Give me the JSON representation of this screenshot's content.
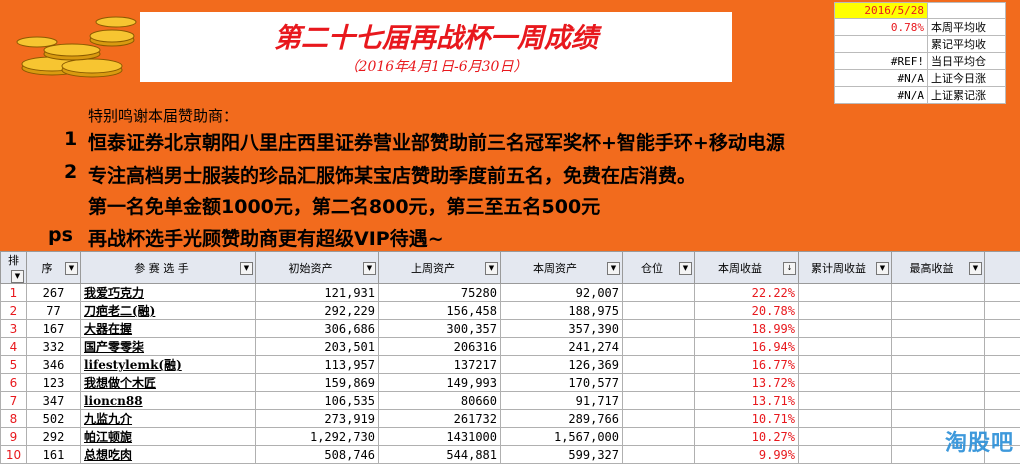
{
  "header": {
    "title": "第二十七届再战杯一周成绩",
    "subtitle": "（2016年4月1日-6月30日）",
    "date": "2016/5/28",
    "stats": [
      {
        "value": "0.78%",
        "label": "本周平均收",
        "red": true
      },
      {
        "value": "",
        "label": "累记平均收",
        "red": false
      },
      {
        "value": "#REF!",
        "label": "当日平均仓",
        "red": false
      },
      {
        "value": "#N/A",
        "label": "上证今日涨",
        "red": false
      },
      {
        "value": "#N/A",
        "label": "上证累记涨",
        "red": false
      }
    ]
  },
  "sponsors": {
    "heading": "特别鸣谢本届赞助商：",
    "item1_num": "1",
    "item1": "恒泰证券北京朝阳八里庄西里证券营业部赞助前三名冠军奖杯+智能手环+移动电源",
    "item2_num": "2",
    "item2": "专注高档男士服装的珍品汇服饰某宝店赞助季度前五名，免费在店消费。",
    "item2b": "第一名免单金额1000元，第二名800元，第三至五名500元",
    "ps_label": "ps",
    "ps": "再战杯选手光顾赞助商更有超级VIP待遇~"
  },
  "table": {
    "columns": [
      "排",
      "序",
      "参 赛 选 手",
      "初始资产",
      "上周资产",
      "本周资产",
      "仓位",
      "本周收益",
      "累计周收益",
      "最高收益"
    ],
    "rows": [
      {
        "rank": "1",
        "id": "267",
        "name": "我爱巧克力",
        "init": "121,931",
        "last": "75280",
        "cur": "92,007",
        "pos": "",
        "gain": "22.22%"
      },
      {
        "rank": "2",
        "id": "77",
        "name": "刀疤老二(融)",
        "init": "292,229",
        "last": "156,458",
        "cur": "188,975",
        "pos": "",
        "gain": "20.78%"
      },
      {
        "rank": "3",
        "id": "167",
        "name": "大器在握",
        "init": "306,686",
        "last": "300,357",
        "cur": "357,390",
        "pos": "",
        "gain": "18.99%"
      },
      {
        "rank": "4",
        "id": "332",
        "name": "国产零零柒",
        "init": "203,501",
        "last": "206316",
        "cur": "241,274",
        "pos": "",
        "gain": "16.94%"
      },
      {
        "rank": "5",
        "id": "346",
        "name": "lifestylemk(融)",
        "init": "113,957",
        "last": "137217",
        "cur": "126,369",
        "pos": "",
        "gain": "16.77%"
      },
      {
        "rank": "6",
        "id": "123",
        "name": "我想做个木匠",
        "init": "159,869",
        "last": "149,993",
        "cur": "170,577",
        "pos": "",
        "gain": "13.72%"
      },
      {
        "rank": "7",
        "id": "347",
        "name": "lioncn88",
        "init": "106,535",
        "last": "80660",
        "cur": "91,717",
        "pos": "",
        "gain": "13.71%"
      },
      {
        "rank": "8",
        "id": "502",
        "name": "九监九介",
        "init": "273,919",
        "last": "261732",
        "cur": "289,766",
        "pos": "",
        "gain": "10.71%"
      },
      {
        "rank": "9",
        "id": "292",
        "name": "帕江顿旎",
        "init": "1,292,730",
        "last": "1431000",
        "cur": "1,567,000",
        "pos": "",
        "gain": "10.27%"
      },
      {
        "rank": "10",
        "id": "161",
        "name": "总想吃肉",
        "init": "508,746",
        "last": "544,881",
        "cur": "599,327",
        "pos": "",
        "gain": "9.99%"
      }
    ]
  },
  "watermark": "淘股吧"
}
